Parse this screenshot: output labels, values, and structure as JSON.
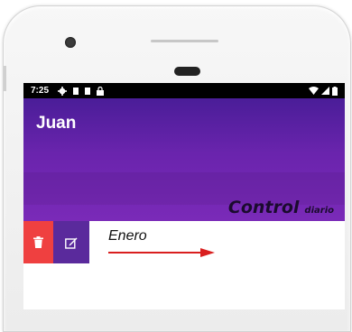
{
  "status": {
    "time": "7:25",
    "icons": [
      "gear-icon",
      "sim-icon",
      "sim-icon",
      "lock-icon"
    ]
  },
  "appbar": {
    "title": "Juan",
    "brand_main": "Control",
    "brand_sub": "diario"
  },
  "list": {
    "items": [
      {
        "label": "Enero",
        "delete": "delete-icon",
        "edit": "edit-icon"
      }
    ]
  },
  "colors": {
    "appbar": "#6a24ad",
    "delete": "#ef4040",
    "edit": "#5a2a9c",
    "arrow": "#d91f1f"
  }
}
